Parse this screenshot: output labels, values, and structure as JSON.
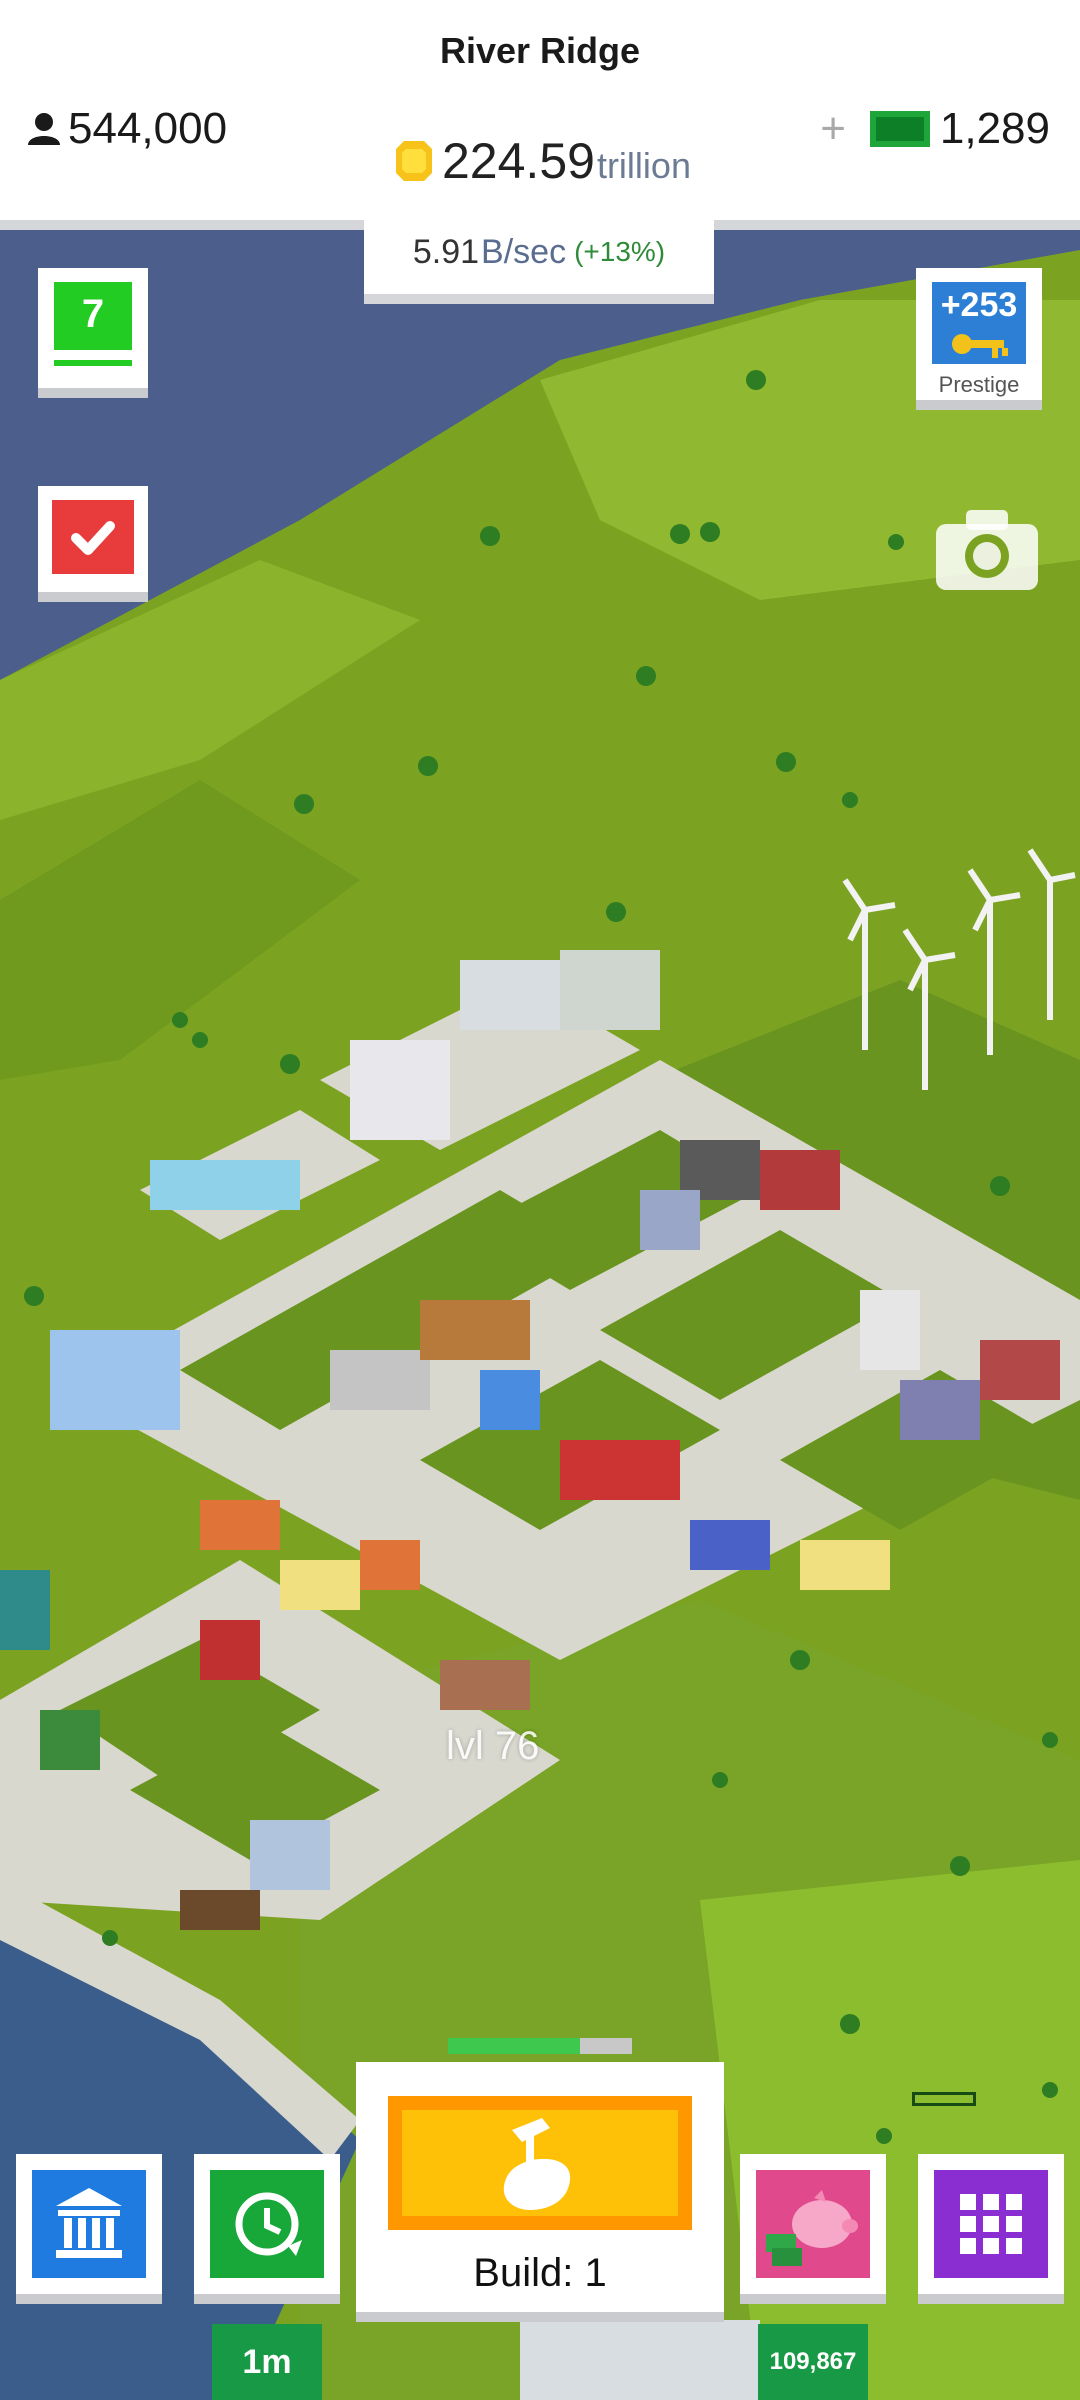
{
  "header": {
    "city_name": "River Ridge",
    "population": "544,000",
    "coins": "224.59",
    "coins_unit": "trillion",
    "cash_add": "+",
    "cash": "1,289"
  },
  "income": {
    "rate": "5.91",
    "rate_unit": "B/sec",
    "bonus": "(+13%)"
  },
  "left_buttons": {
    "level": "7",
    "level_progress": 1.0
  },
  "prestige": {
    "value": "+253",
    "label": "Prestige"
  },
  "map": {
    "building_level_label": "lvl 76"
  },
  "build": {
    "label": "Build: 1",
    "progress": 0.72
  },
  "bottom_bar": {
    "time_tag": "1m",
    "piggy_tag": "109,867"
  },
  "colors": {
    "level_green": "#22cc22",
    "tasks_red": "#e83b3b",
    "prestige_blue": "#2d7fd6",
    "build_orange": "#ff9800",
    "bank_blue": "#1f7be0",
    "time_green": "#18a83a",
    "piggy_pink": "#e04a8c",
    "grid_purple": "#8a2ed2",
    "tag_green": "#179945"
  }
}
